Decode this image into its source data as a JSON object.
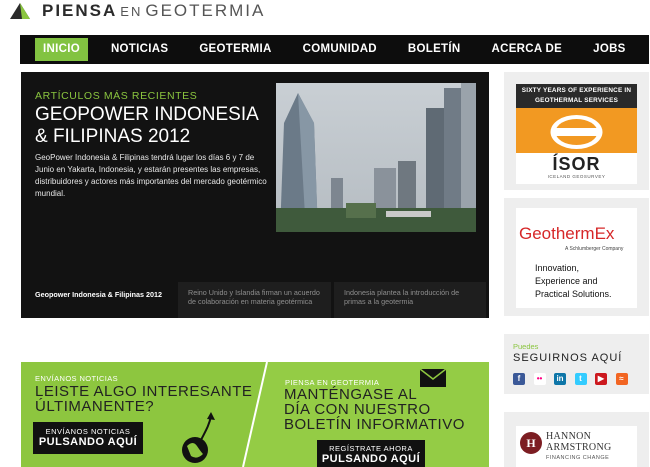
{
  "logo": {
    "word1": "PIENSA",
    "word2": "EN",
    "word3": "GEOTERMIA"
  },
  "nav": {
    "items": [
      {
        "label": "INICIO",
        "active": true
      },
      {
        "label": "NOTICIAS"
      },
      {
        "label": "GEOTERMIA"
      },
      {
        "label": "COMUNIDAD"
      },
      {
        "label": "BOLETÍN"
      },
      {
        "label": "ACERCA DE"
      },
      {
        "label": "JOBS"
      }
    ]
  },
  "feature": {
    "label": "ARTÍCULOS MÁS RECIENTES",
    "title_line1": "GEOPOWER INDONESIA",
    "title_line2": "& FILIPINAS 2012",
    "description": "GeoPower Indonesia & Filipinas tendrá lugar los días 6 y 7 de Junio en Yakarta, Indonesia, y estarán presentes las empresas, distribuidores y actores más importantes del mercado geotérmico mundial.",
    "tabs": [
      {
        "caption": "Geopower Indonesia & Filipinas 2012"
      },
      {
        "caption": "Reino Unido y Islandia firman un acuerdo de colaboración en materia geotérmica"
      },
      {
        "caption": "Indonesia plantea la introducción de primas a la geotermia"
      }
    ]
  },
  "sidebar": {
    "isor": {
      "tagline": "SIXTY YEARS OF EXPERIENCE IN GEOTHERMAL SERVICES",
      "name": "ÍSOR",
      "sub": "ICELAND GEOSURVEY"
    },
    "geothermex": {
      "name": "GeothermEx",
      "sub": "A Schlumberger Company",
      "line1": "Innovation,",
      "line2": "Experience and",
      "line3": "Practical Solutions."
    },
    "social": {
      "label": "Puedes",
      "title": "SEGUIRNOS AQUÍ",
      "icons": [
        {
          "name": "facebook-icon",
          "glyph": "f",
          "color": "#3b5998"
        },
        {
          "name": "flickr-icon",
          "glyph": "••",
          "color": "#ff0084"
        },
        {
          "name": "linkedin-icon",
          "glyph": "in",
          "color": "#0e76a8"
        },
        {
          "name": "twitter-icon",
          "glyph": "t",
          "color": "#33ccff"
        },
        {
          "name": "youtube-icon",
          "glyph": "▶",
          "color": "#cc181e"
        },
        {
          "name": "rss-icon",
          "glyph": "≈",
          "color": "#f26522"
        }
      ]
    },
    "hannon": {
      "mark": "H",
      "line1": "HANNON",
      "line2": "ARMSTRONG",
      "sub": "FINANCING CHANGE"
    }
  },
  "banners": {
    "left": {
      "small": "ENVÍANOS NOTICIAS",
      "big_line1": "LEISTE ALGO INTERESANTE",
      "big_line2": "ÚLTIMANENTE?",
      "button_line1": "ENVÍANOS NOTICIAS",
      "button_line2": "PULSANDO AQUÍ"
    },
    "right": {
      "small": "PIENSA EN GEOTERMIA",
      "big_line1": "MANTÉNGASE AL",
      "big_line2": "DÍA CON NUESTRO",
      "big_line3": "BOLETÍN INFORMATIVO",
      "button_line1": "REGÍSTRATE AHORA",
      "button_line2": "PULSANDO AQUÍ"
    }
  }
}
